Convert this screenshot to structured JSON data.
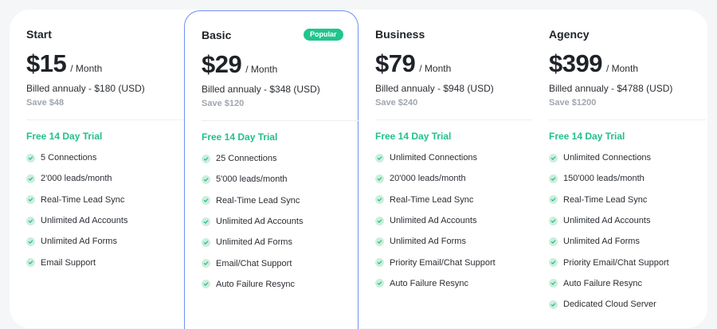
{
  "colors": {
    "accent_green": "#22c08a",
    "badge_bg": "#1fc58e",
    "highlight_border": "#6f8ff0"
  },
  "plans": [
    {
      "name": "Start",
      "badge": "",
      "price": "$15",
      "period": "/ Month",
      "billed": "Billed annualy - $180 (USD)",
      "save": "Save $48",
      "trial": "Free 14 Day Trial",
      "features": [
        "5 Connections",
        "2'000 leads/month",
        "Real-Time Lead Sync",
        "Unlimited Ad Accounts",
        "Unlimited Ad Forms",
        "Email Support"
      ]
    },
    {
      "name": "Basic",
      "badge": "Popular",
      "price": "$29",
      "period": "/ Month",
      "billed": "Billed annualy - $348 (USD)",
      "save": "Save $120",
      "trial": "Free 14 Day Trial",
      "features": [
        "25 Connections",
        "5'000 leads/month",
        "Real-Time Lead Sync",
        "Unlimited Ad Accounts",
        "Unlimited Ad Forms",
        "Email/Chat Support",
        "Auto Failure Resync"
      ]
    },
    {
      "name": "Business",
      "badge": "",
      "price": "$79",
      "period": "/ Month",
      "billed": "Billed annualy - $948 (USD)",
      "save": "Save $240",
      "trial": "Free 14 Day Trial",
      "features": [
        "Unlimited Connections",
        "20'000 leads/month",
        "Real-Time Lead Sync",
        "Unlimited Ad Accounts",
        "Unlimited Ad Forms",
        "Priority Email/Chat Support",
        "Auto Failure Resync"
      ]
    },
    {
      "name": "Agency",
      "badge": "",
      "price": "$399",
      "period": "/ Month",
      "billed": "Billed annualy - $4788 (USD)",
      "save": "Save $1200",
      "trial": "Free 14 Day Trial",
      "features": [
        "Unlimited Connections",
        "150'000 leads/month",
        "Real-Time Lead Sync",
        "Unlimited Ad Accounts",
        "Unlimited Ad Forms",
        "Priority Email/Chat Support",
        "Auto Failure Resync",
        "Dedicated Cloud Server"
      ]
    }
  ]
}
